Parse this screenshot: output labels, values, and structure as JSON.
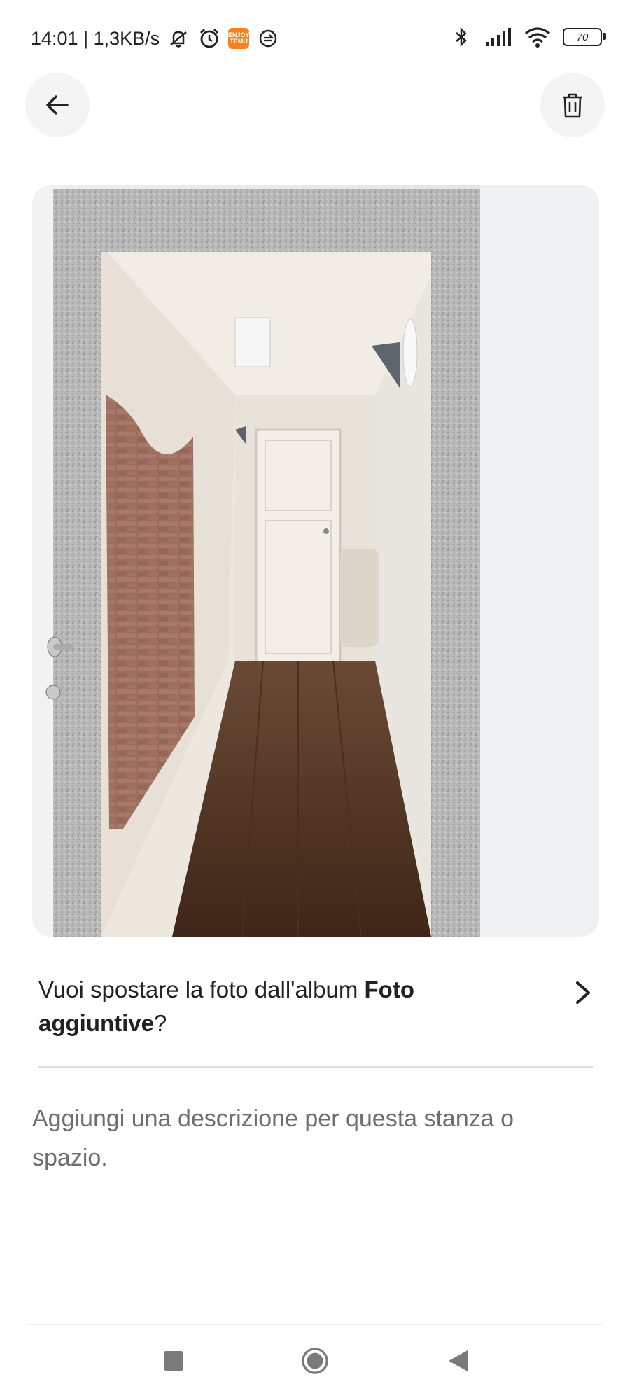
{
  "status_bar": {
    "time_speed": "14:01 | 1,3KB/s",
    "temu_badge": "ENJOY TEMU",
    "battery_level": "70"
  },
  "photo": {
    "subject": "hallway-photo"
  },
  "move_prompt": {
    "prefix": "Vuoi spostare la foto dall'album ",
    "album_name": "Foto aggiuntive",
    "suffix": "?"
  },
  "description": {
    "placeholder": "Aggiungi una descrizione per questa stanza o spazio."
  },
  "colors": {
    "background": "#ffffff",
    "circle_button": "#f4f4f4",
    "placeholder_text": "#6e6e6e",
    "temu_orange": "#f6821f"
  },
  "icons": {
    "back": "arrow-left",
    "trash": "trash-can",
    "chevron": "chevron-right",
    "nav_recent": "square",
    "nav_home": "circle",
    "nav_back": "triangle-left"
  }
}
